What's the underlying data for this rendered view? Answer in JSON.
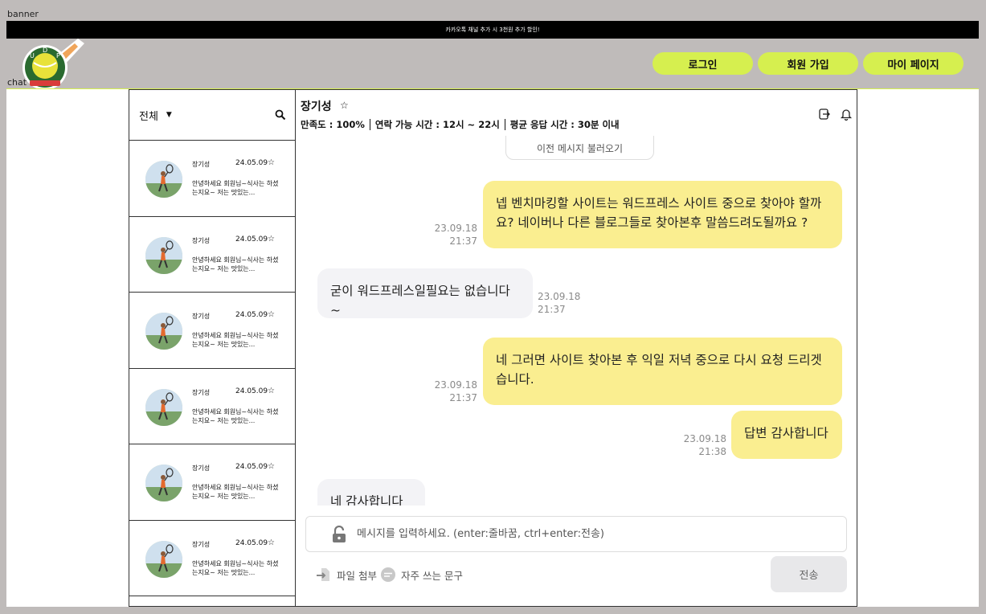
{
  "labels": {
    "banner": "banner",
    "chat": "chat"
  },
  "banner": {
    "text": "카카오톡 채널 추가 시 3천원 추가 할인!"
  },
  "nav": {
    "login": "로그인",
    "signup": "회원 가입",
    "mypage": "마이 페이지"
  },
  "colors": {
    "accent": "#d6ef4f",
    "my_bubble": "#faee90",
    "other_bubble": "#f3f3f6",
    "page_bg": "#bfbbba"
  },
  "sidebar": {
    "filter": "전체",
    "items": [
      {
        "name": "장기성",
        "date": "24.05.09",
        "star": "☆",
        "preview": "안녕하세요 회원님~식사는 하셨는지요~ 저는 맛있는..."
      },
      {
        "name": "장기성",
        "date": "24.05.09",
        "star": "☆",
        "preview": "안녕하세요 회원님~식사는 하셨는지요~ 저는 맛있는..."
      },
      {
        "name": "장기성",
        "date": "24.05.09",
        "star": "☆",
        "preview": "안녕하세요 회원님~식사는 하셨는지요~ 저는 맛있는..."
      },
      {
        "name": "장기성",
        "date": "24.05.09",
        "star": "☆",
        "preview": "안녕하세요 회원님~식사는 하셨는지요~ 저는 맛있는..."
      },
      {
        "name": "장기성",
        "date": "24.05.09",
        "star": "☆",
        "preview": "안녕하세요 회원님~식사는 하셨는지요~ 저는 맛있는..."
      },
      {
        "name": "장기성",
        "date": "24.05.09",
        "star": "☆",
        "preview": "안녕하세요 회원님~식사는 하셨는지요~ 저는 맛있는..."
      }
    ]
  },
  "room": {
    "name": "장기성",
    "star": "☆",
    "satisfaction": "만족도 : 100%",
    "contact_hours": "연락 가능 시간 : 12시 ~ 22시",
    "avg_response": "평균 응답 시간 : 30분 이내"
  },
  "messages": {
    "older": "이전 메시지 불러오기",
    "list": [
      {
        "text": "넵 벤치마킹할 사이트는 워드프레스 사이트 중으로 찾아야 할까요? 네이버나 다른 블로그들로 찾아본후 말씀드려도될까요 ?",
        "date": "23.09.18",
        "time": "21:37"
      },
      {
        "text": "굳이 워드프레스일필요는 없습니다 ~",
        "date": "23.09.18",
        "time": "21:37"
      },
      {
        "text": "네 그러면 사이트 찾아본 후 익일 저녁 중으로 다시 요청 드리겟습니다.",
        "date": "23.09.18",
        "time": "21:37"
      },
      {
        "text": "답변 감사합니다",
        "date": "23.09.18",
        "time": "21:38"
      },
      {
        "text": "네 감사합니다",
        "date": "",
        "time": ""
      }
    ]
  },
  "composer": {
    "placeholder": "메시지를 입력하세요. (enter:줄바꿈, ctrl+enter:전송)",
    "attach": "파일 첨부",
    "phrases": "자주 쓰는 문구",
    "send": "전송"
  }
}
